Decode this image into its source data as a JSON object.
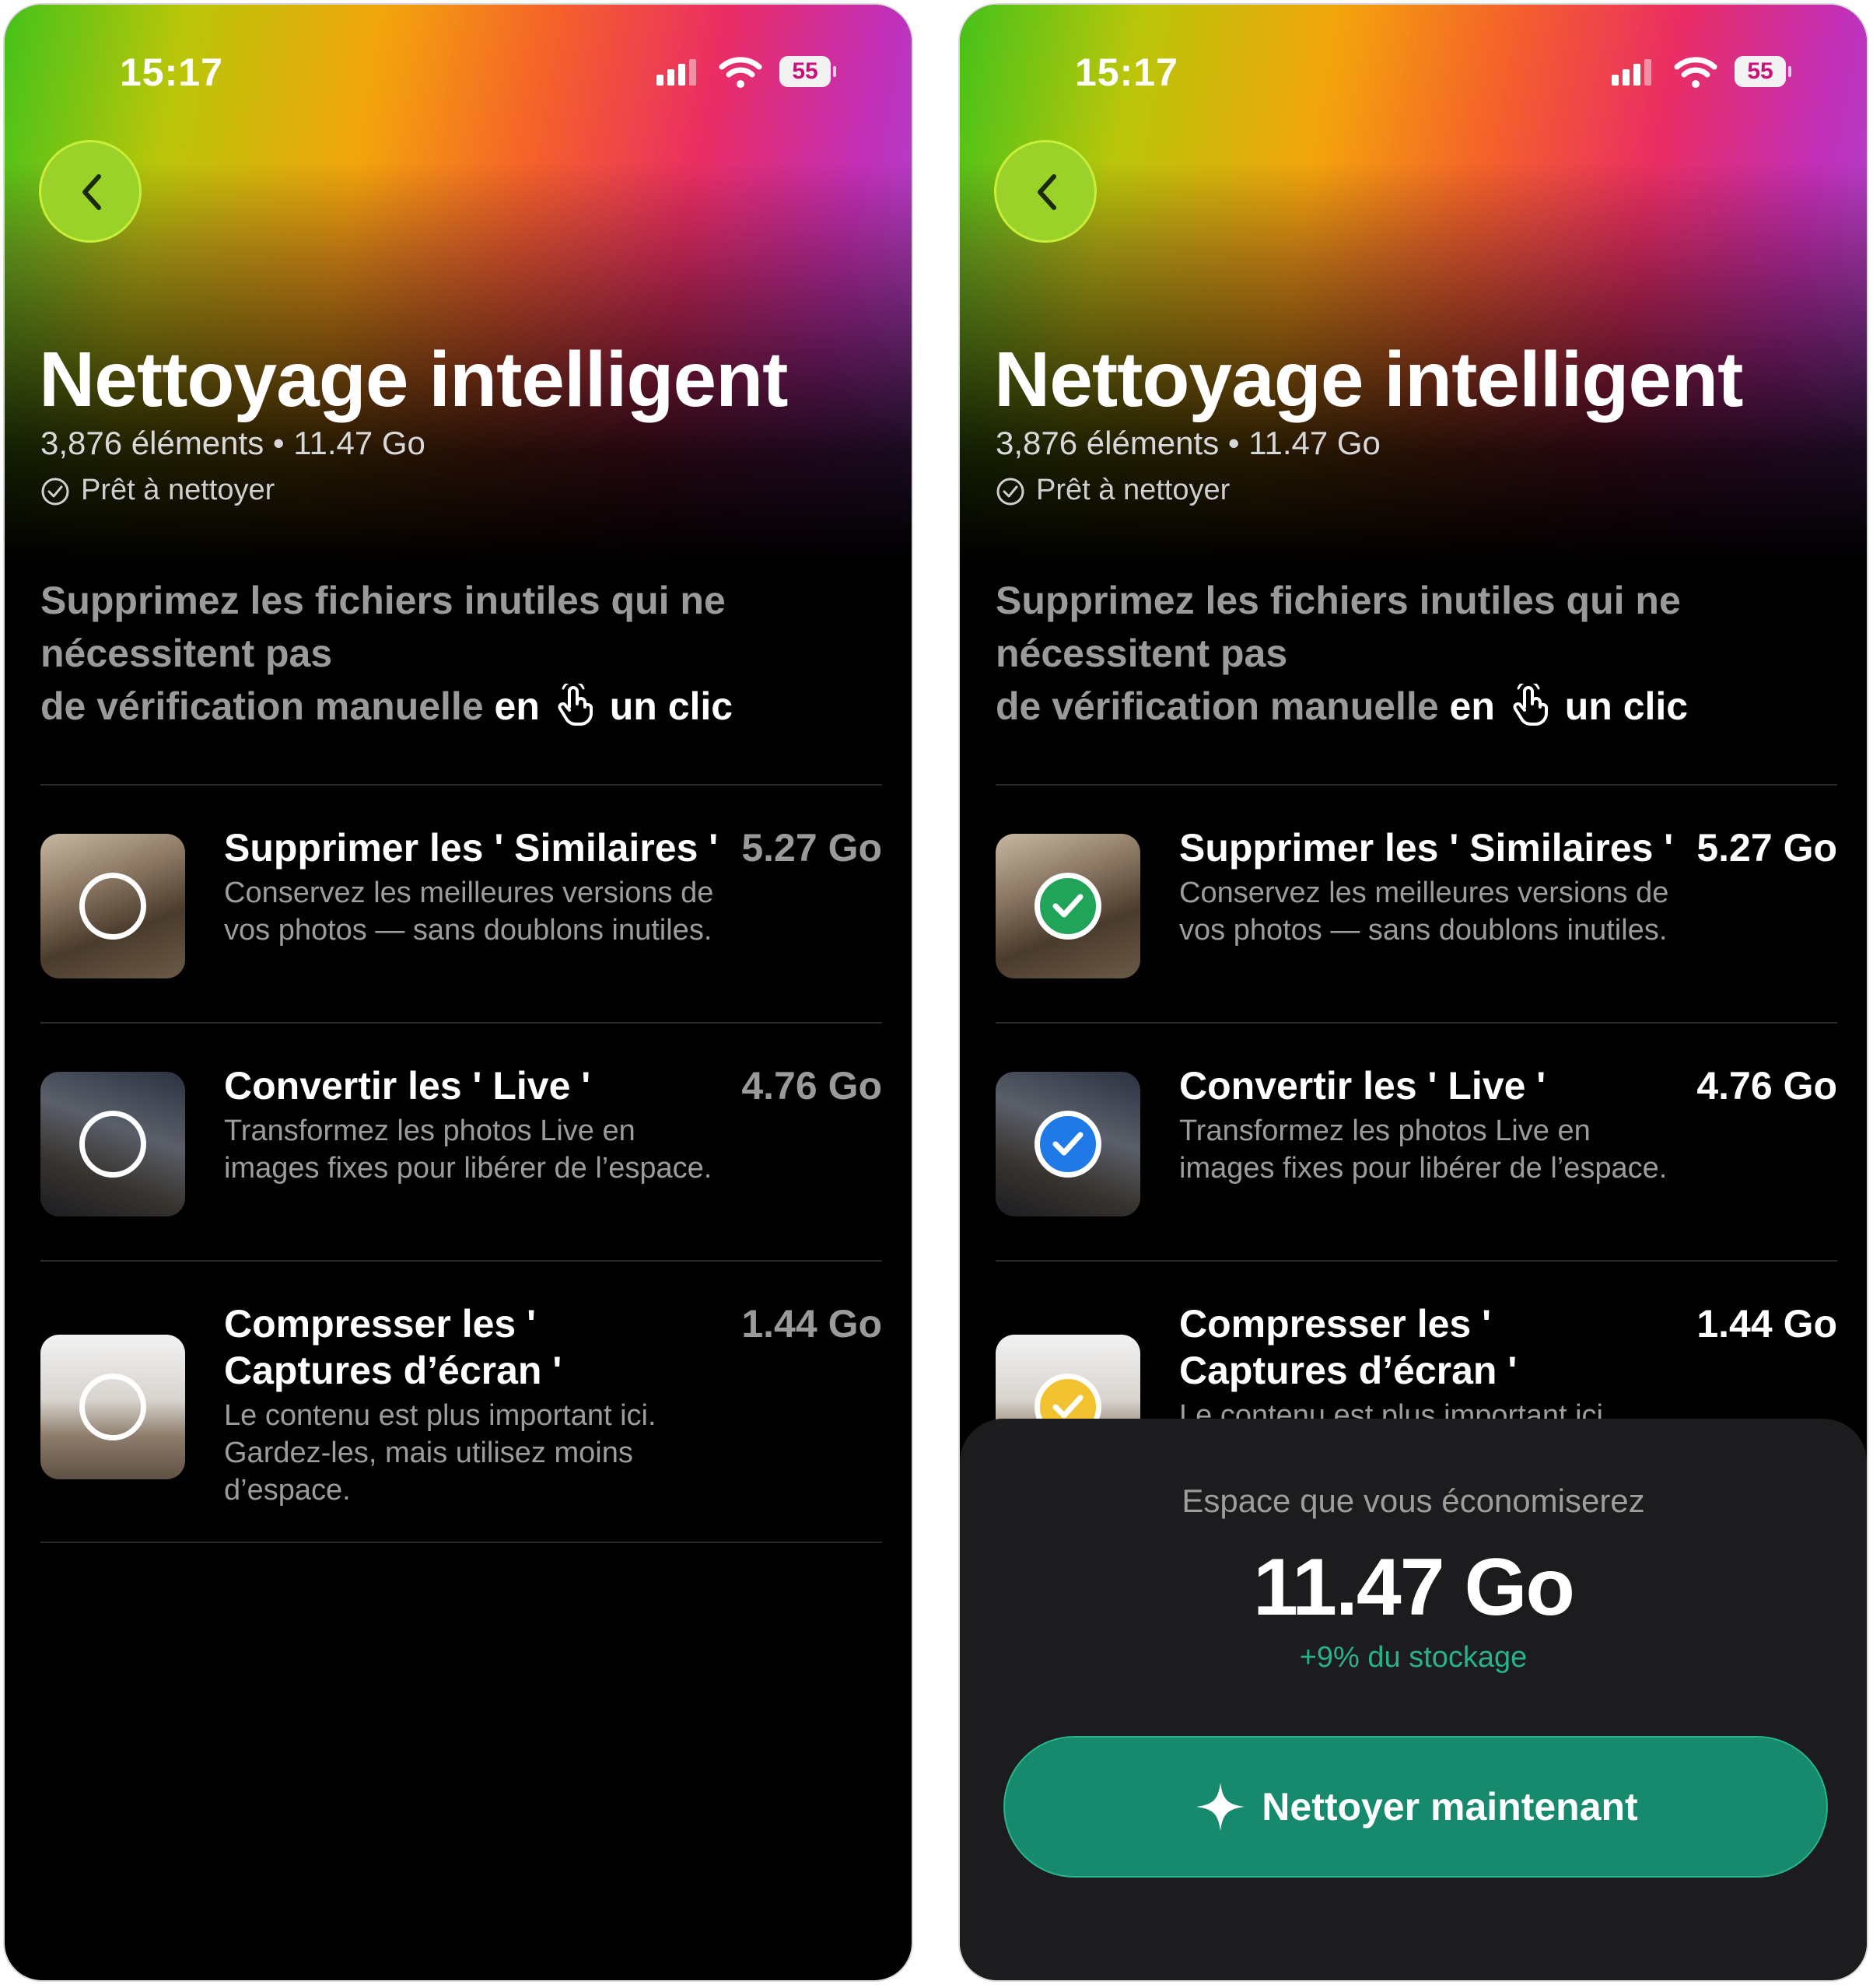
{
  "colors": {
    "background": "#000000",
    "accent_green": "#17896d",
    "check_green": "#22a35a",
    "check_blue": "#1f7ae8",
    "check_yellow": "#f2c230",
    "size_dim": "#9a9a9a",
    "size_bright": "#ffffff"
  },
  "screens": [
    {
      "status_bar": {
        "time": "15:17",
        "battery": "55",
        "icons": [
          "signal-icon",
          "wifi-icon",
          "battery-icon"
        ]
      },
      "header": {
        "back_icon": "chevron-left-icon",
        "title": "Nettoyage intelligent",
        "meta": "3,876 éléments • 11.47 Go",
        "ready_label": "Prêt à nettoyer",
        "ready_icon": "check-circle-icon"
      },
      "description": {
        "line1": "Supprimez les fichiers inutiles qui ne",
        "line2": "nécessitent pas",
        "line3_dim": "de vérification manuelle",
        "line3_em": "en",
        "hand_icon": "tap-hand-icon",
        "line3_end": "un clic"
      },
      "items": [
        {
          "title": "Supprimer les ' Similaires '",
          "size": "5.27 Go",
          "description": "Conservez les meilleures versions de vos photos — sans doublons inutiles.",
          "selected": false
        },
        {
          "title": "Convertir les ' Live '",
          "size": "4.76 Go",
          "description": "Transformez les photos Live en images fixes pour libérer de l’espace.",
          "selected": false
        },
        {
          "title_line1": "Compresser les '",
          "title_line2": "Captures d’écran '",
          "size": "1.44 Go",
          "description": "Le contenu est plus important ici. Gardez-les, mais utilisez moins d’espace.",
          "selected": false
        }
      ]
    },
    {
      "status_bar": {
        "time": "15:17",
        "battery": "55",
        "icons": [
          "signal-icon",
          "wifi-icon",
          "battery-icon"
        ]
      },
      "header": {
        "back_icon": "chevron-left-icon",
        "title": "Nettoyage intelligent",
        "meta": "3,876 éléments • 11.47 Go",
        "ready_label": "Prêt à nettoyer",
        "ready_icon": "check-circle-icon"
      },
      "description": {
        "line1": "Supprimez les fichiers inutiles qui ne",
        "line2": "nécessitent pas",
        "line3_dim": "de vérification manuelle",
        "line3_em": "en",
        "hand_icon": "tap-hand-icon",
        "line3_end": "un clic"
      },
      "items": [
        {
          "title": "Supprimer les ' Similaires '",
          "size": "5.27 Go",
          "description": "Conservez les meilleures versions de vos photos — sans doublons inutiles.",
          "selected": true
        },
        {
          "title": "Convertir les ' Live '",
          "size": "4.76 Go",
          "description": "Transformez les photos Live en images fixes pour libérer de l’espace.",
          "selected": true
        },
        {
          "title_line1": "Compresser les '",
          "title_line2": "Captures d’écran '",
          "size": "1.44 Go",
          "description": "Le contenu est plus important ici.",
          "selected": true
        }
      ],
      "summary": {
        "label": "Espace que vous économiserez",
        "value": "11.47 Go",
        "storage_share": "+9% du stockage",
        "button_label": "Nettoyer maintenant",
        "button_icon": "sparkle-icon"
      }
    }
  ]
}
